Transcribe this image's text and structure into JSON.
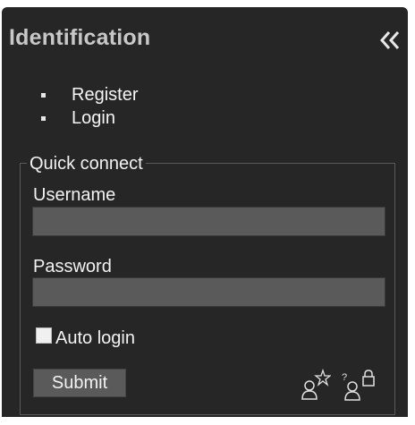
{
  "panel": {
    "title": "Identification",
    "collapse_icon": "double-chevron-left-icon"
  },
  "links": [
    {
      "label": "Register"
    },
    {
      "label": "Login"
    }
  ],
  "quick_connect": {
    "legend": "Quick connect",
    "username": {
      "label": "Username",
      "value": "",
      "placeholder": ""
    },
    "password": {
      "label": "Password",
      "value": "",
      "placeholder": ""
    },
    "auto_login": {
      "label": "Auto login",
      "checked": false
    },
    "submit_label": "Submit",
    "icons": [
      "register-user-icon",
      "lost-password-icon"
    ]
  },
  "colors": {
    "panel_bg": "#262626",
    "title": "#c8c8c8",
    "field_bg": "#5a5a5a",
    "text": "#f2f2f2"
  }
}
